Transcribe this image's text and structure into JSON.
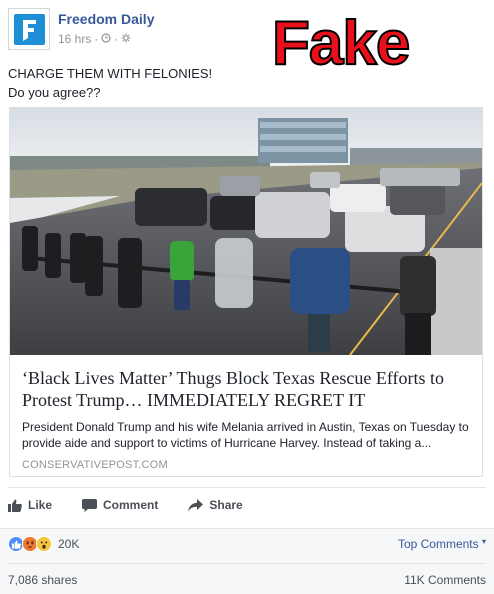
{
  "post": {
    "page_name": "Freedom Daily",
    "time": "16 hrs",
    "separator": "·",
    "status_line1": "CHARGE THEM WITH FELONIES!",
    "status_line2": "Do you agree??"
  },
  "stamp": {
    "text": "Fake",
    "color": "#e8101a"
  },
  "link_card": {
    "title": "‘Black Lives Matter’ Thugs Block Texas Rescue Efforts to Protest Trump… IMMEDIATELY REGRET IT",
    "description": "President Donald Trump and his wife Melania arrived in Austin, Texas on Tuesday to provide aide and support to victims of Hurricane Harvey. Instead of taking a...",
    "domain": "CONSERVATIVEPOST.COM"
  },
  "actions": {
    "like": "Like",
    "comment": "Comment",
    "share": "Share"
  },
  "engagement": {
    "reaction_count": "20K",
    "top_comments": "Top Comments",
    "shares": "7,086 shares",
    "comments": "11K Comments"
  },
  "colors": {
    "link_blue": "#365899",
    "logo_blue": "#1f8fd6"
  }
}
